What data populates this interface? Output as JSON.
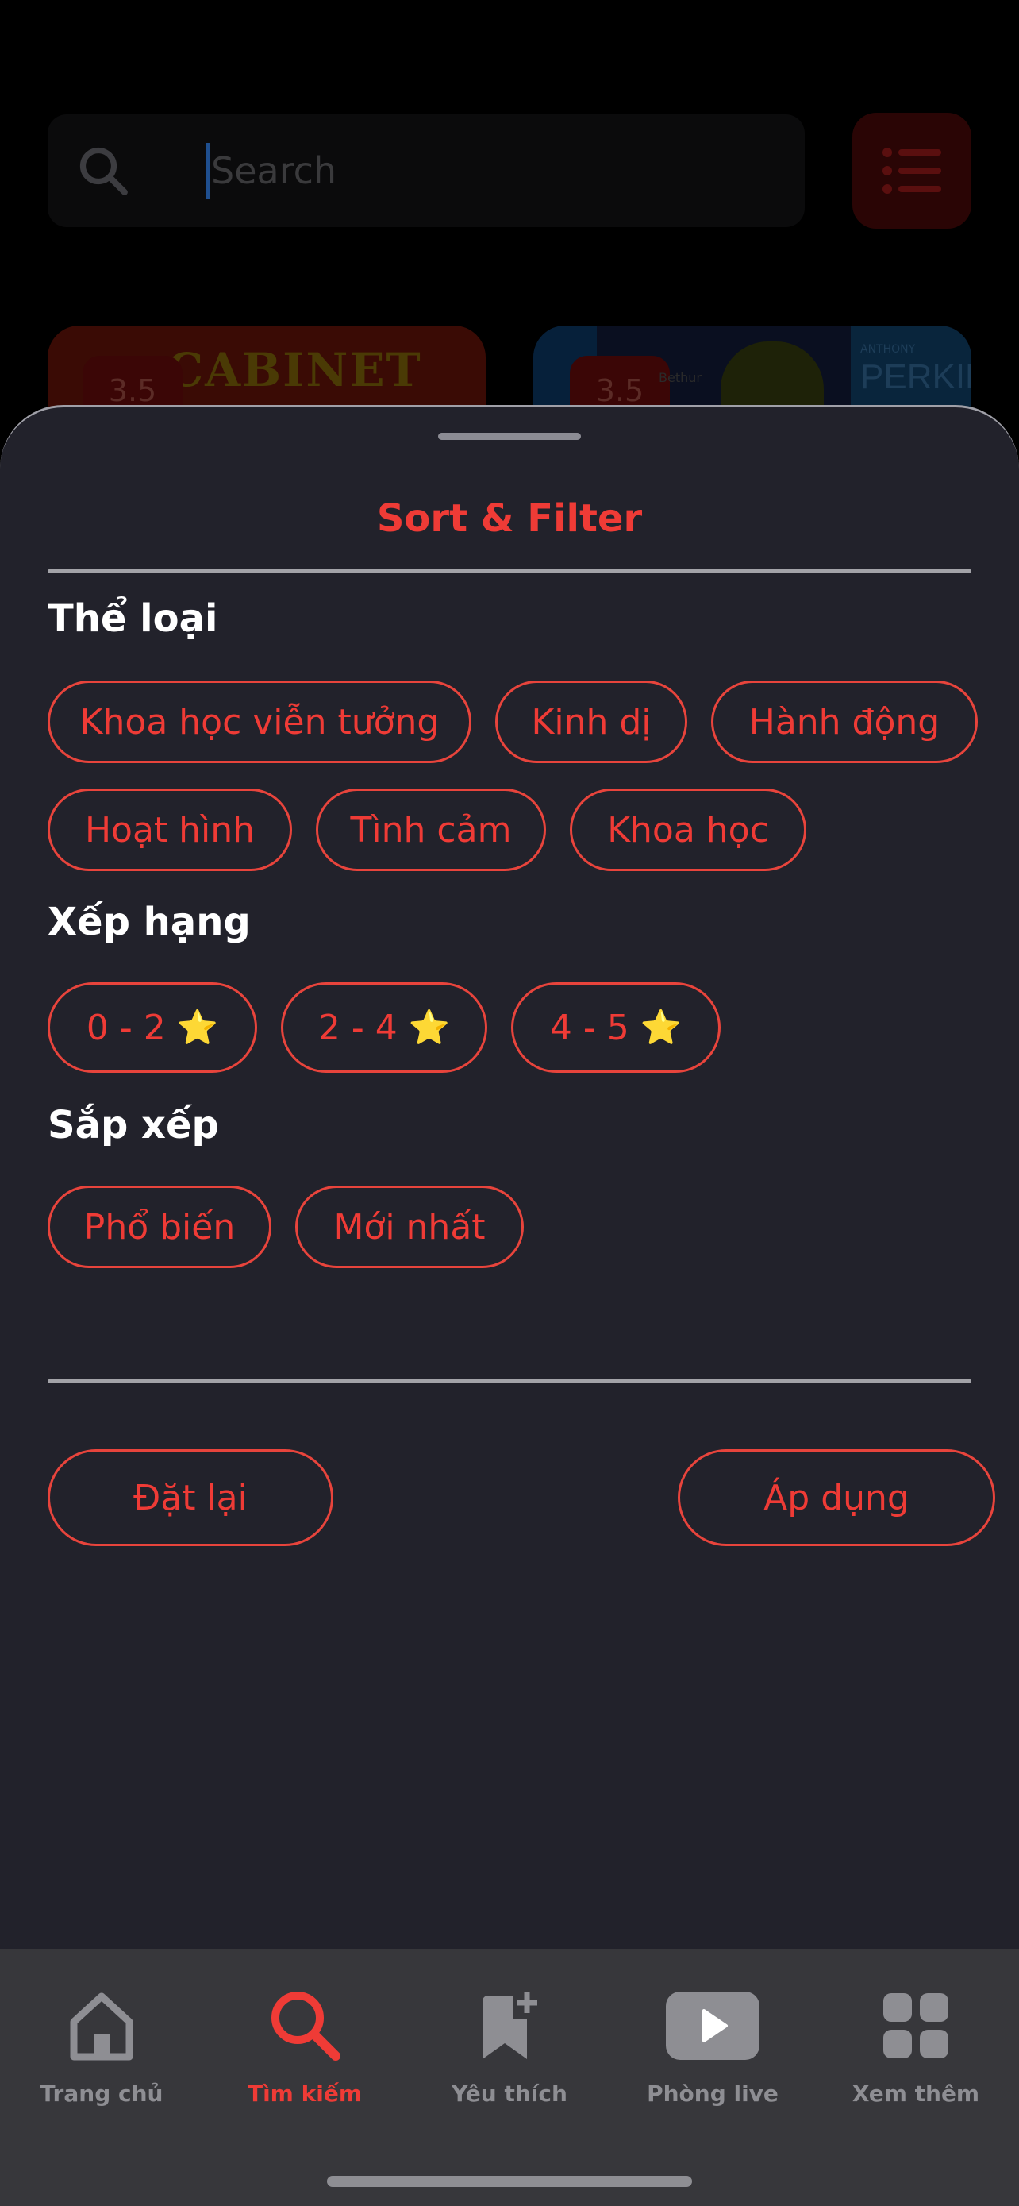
{
  "search": {
    "placeholder": "Search"
  },
  "background_posters": [
    {
      "title_art": "CABINET",
      "rating": "3.5"
    },
    {
      "title_art": "PERKINS",
      "rating": "3.5",
      "small_text": "ANTHONY",
      "tiny_text": "Bethur"
    }
  ],
  "sheet": {
    "title": "Sort & Filter",
    "sections": {
      "genre": {
        "title": "Thể loại",
        "chips": [
          "Khoa học viễn tưởng",
          "Kinh dị",
          "Hành động",
          "Hoạt hình",
          "Tình cảm",
          "Khoa học"
        ]
      },
      "rating": {
        "title": "Xếp hạng",
        "chips": [
          "0 - 2",
          "2 - 4",
          "4 - 5"
        ],
        "star": "⭐"
      },
      "sort": {
        "title": "Sắp xếp",
        "chips": [
          "Phổ biến",
          "Mới nhất"
        ]
      }
    },
    "buttons": {
      "reset": "Đặt lại",
      "apply": "Áp dụng"
    }
  },
  "nav": {
    "items": [
      {
        "label": "Trang chủ",
        "icon": "home-icon",
        "active": false
      },
      {
        "label": "Tìm kiếm",
        "icon": "search-icon",
        "active": true
      },
      {
        "label": "Yêu thích",
        "icon": "bookmark-add-icon",
        "active": false
      },
      {
        "label": "Phòng live",
        "icon": "play-icon",
        "active": false
      },
      {
        "label": "Xem thêm",
        "icon": "grid-icon",
        "active": false
      }
    ]
  },
  "colors": {
    "accent": "#ef3b36",
    "sheet_bg": "#22222b",
    "nav_bg": "#37373b",
    "inactive": "#8e8e93"
  }
}
